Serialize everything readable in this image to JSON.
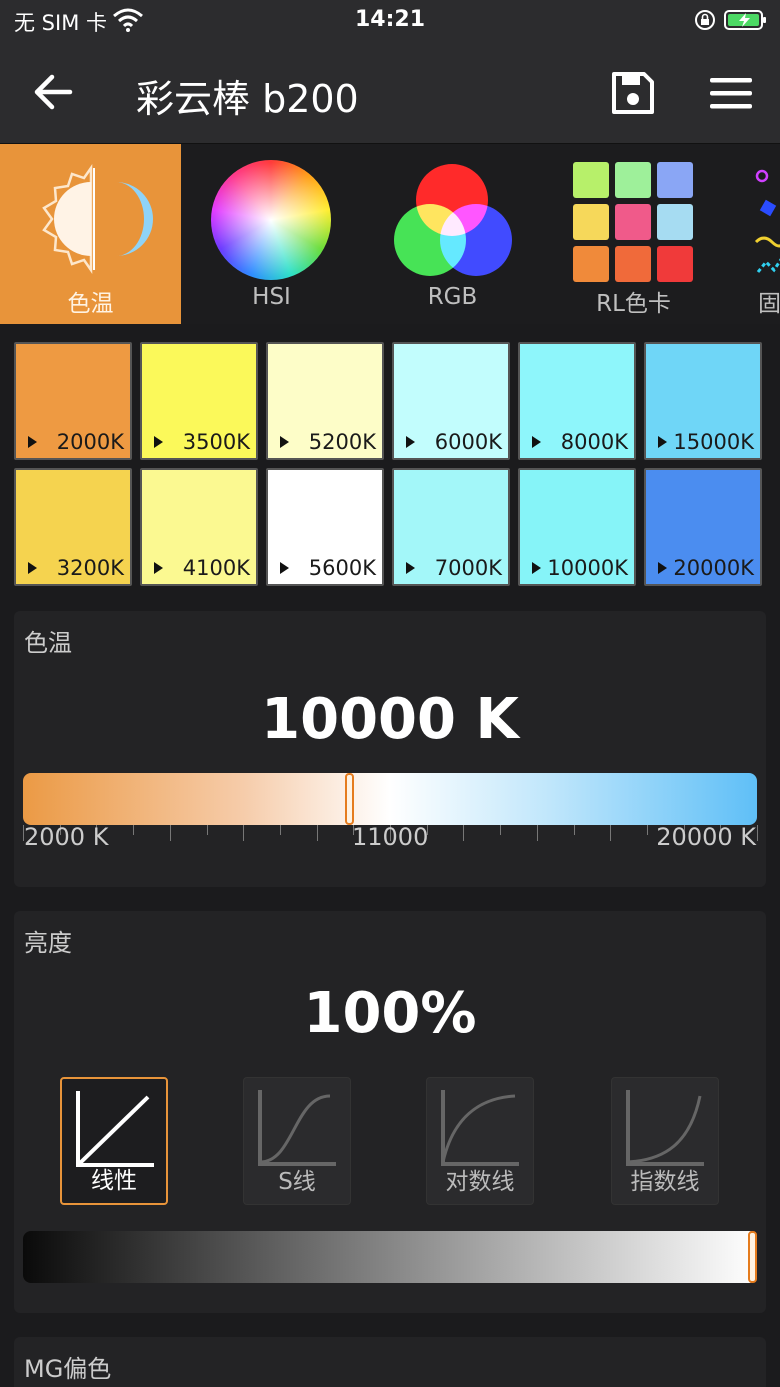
{
  "status_bar": {
    "carrier": "无 SIM 卡",
    "time": "14:21"
  },
  "nav": {
    "title": "彩云棒 b200"
  },
  "modes": [
    {
      "label": "色温",
      "active": true
    },
    {
      "label": "HSI",
      "active": false
    },
    {
      "label": "RGB",
      "active": false
    },
    {
      "label": "RL色卡",
      "active": false
    },
    {
      "label": "固",
      "active": false
    }
  ],
  "presets": [
    {
      "label": "2000K",
      "color": "#ee9a42"
    },
    {
      "label": "3500K",
      "color": "#fbf95a"
    },
    {
      "label": "5200K",
      "color": "#fdfdc8"
    },
    {
      "label": "6000K",
      "color": "#c2fdfd"
    },
    {
      "label": "8000K",
      "color": "#8ef6fb"
    },
    {
      "label": "15000K",
      "color": "#6fd6f7"
    },
    {
      "label": "3200K",
      "color": "#f5d34f"
    },
    {
      "label": "4100K",
      "color": "#fbf991"
    },
    {
      "label": "5600K",
      "color": "#ffffff"
    },
    {
      "label": "7000K",
      "color": "#a3f7f9"
    },
    {
      "label": "10000K",
      "color": "#86f4f8"
    },
    {
      "label": "20000K",
      "color": "#4b8df0"
    }
  ],
  "cct": {
    "label": "色温",
    "value_text": "10000 K",
    "value": 10000,
    "min_label": "2000 K",
    "mid_label": "11000",
    "max_label": "20000 K"
  },
  "brightness": {
    "label": "亮度",
    "value_text": "100%",
    "value": 100,
    "curves": [
      {
        "label": "线性",
        "active": true
      },
      {
        "label": "S线",
        "active": false
      },
      {
        "label": "对数线",
        "active": false
      },
      {
        "label": "指数线",
        "active": false
      }
    ]
  },
  "mg": {
    "label": "MG偏色"
  }
}
